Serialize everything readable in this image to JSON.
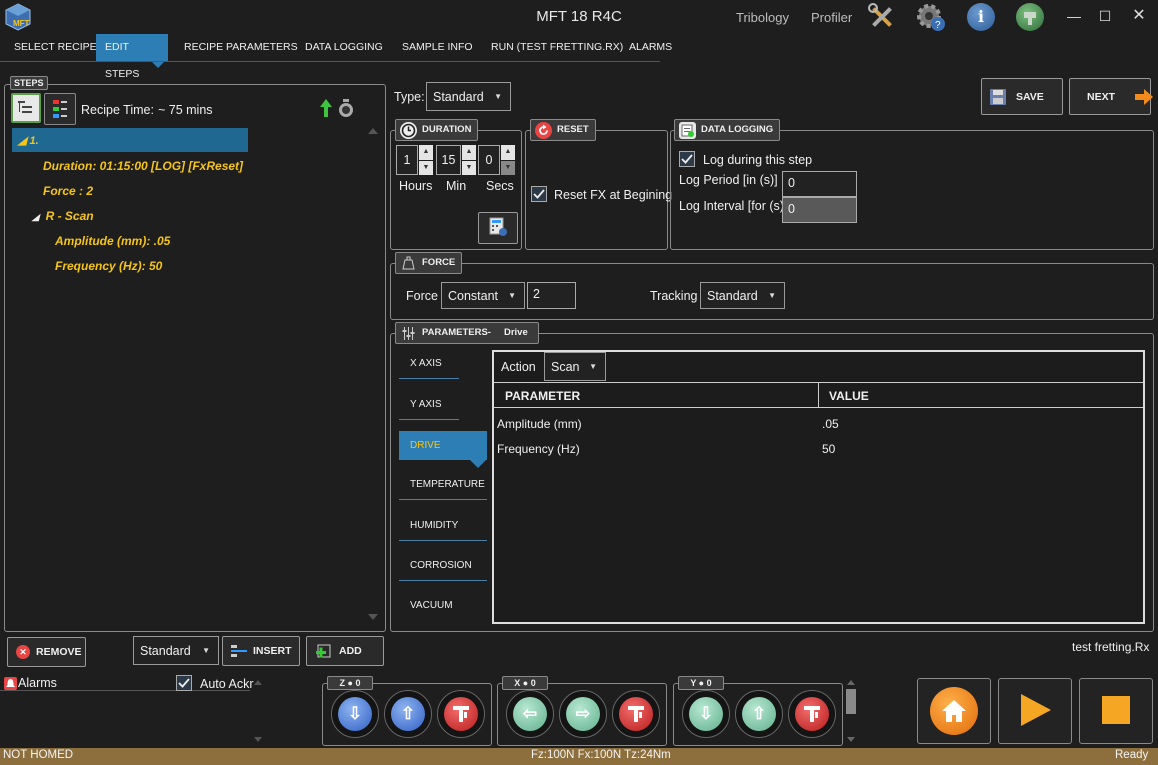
{
  "window": {
    "title": "MFT 18 R4C",
    "links": [
      "Tribology",
      "Profiler"
    ],
    "logo_text": "MFT"
  },
  "menu": {
    "items": [
      "SELECT RECIPE",
      "EDIT STEPS",
      "RECIPE PARAMETERS",
      "DATA LOGGING",
      "SAMPLE INFO",
      "RUN (TEST FRETTING.RX)",
      "ALARMS"
    ],
    "active_index": 1
  },
  "steps": {
    "label": "STEPS",
    "recipe_time_label": "Recipe Time:",
    "recipe_time_value": "~ 75 mins",
    "tree": {
      "root": "1.",
      "duration": "Duration: 01:15:00 [LOG] [FxReset]",
      "force": "Force : 2",
      "child": "R - Scan",
      "amplitude": "Amplitude (mm): .05",
      "frequency": "Frequency (Hz): 50"
    }
  },
  "bottom_left": {
    "remove_label": "REMOVE",
    "mode_value": "Standard",
    "insert_label": "INSERT",
    "add_label": "ADD",
    "alarms_label": "Alarms",
    "auto_ack_label": "Auto Ackr"
  },
  "type": {
    "label": "Type:",
    "value": "Standard"
  },
  "actions": {
    "save_label": "SAVE",
    "next_label": "NEXT"
  },
  "duration": {
    "label": "DURATION",
    "hours": "1",
    "minutes": "15",
    "seconds": "0",
    "hours_label": "Hours",
    "minutes_label": "Min",
    "seconds_label": "Secs"
  },
  "reset": {
    "label": "RESET",
    "check_label": "Reset FX at Begining",
    "checked": true
  },
  "data_logging": {
    "label": "DATA LOGGING",
    "log_during_label": "Log during this step",
    "log_during_checked": true,
    "log_period_label": "Log Period [in (s)]",
    "log_period_value": "0",
    "log_interval_label": "Log Interval [for (s)]",
    "log_interval_value": "0"
  },
  "force": {
    "label": "FORCE",
    "force_label": "Force",
    "mode": "Constant",
    "value": "2",
    "tracking_label": "Tracking",
    "tracking_value": "Standard"
  },
  "parameters": {
    "label": "PARAMETERS-",
    "sublabel": "Drive",
    "tabs": [
      "X AXIS",
      "Y AXIS",
      "DRIVE",
      "TEMPERATURE",
      "HUMIDITY",
      "CORROSION",
      "VACUUM"
    ],
    "active_tab": 2,
    "action_label": "Action",
    "action_value": "Scan",
    "columns": [
      "PARAMETER",
      "VALUE"
    ],
    "rows": [
      {
        "parameter": "Amplitude (mm)",
        "value": ".05"
      },
      {
        "parameter": "Frequency (Hz)",
        "value": "50"
      }
    ]
  },
  "recipe_file": "test fretting.Rx",
  "axes": {
    "z": {
      "label": "Z ● 0"
    },
    "x": {
      "label": "X ● 0"
    },
    "y": {
      "label": "Y ● 0"
    }
  },
  "status": {
    "left": "NOT HOMED",
    "center": "Fz:100N Fx:100N Tz:24Nm",
    "right": "Ready"
  },
  "colors": {
    "accent": "#2d7eb5",
    "tree_text": "#f5c518",
    "status_bar": "#8c6f3c",
    "home": "#f28a1c",
    "play": "#f5a623"
  }
}
